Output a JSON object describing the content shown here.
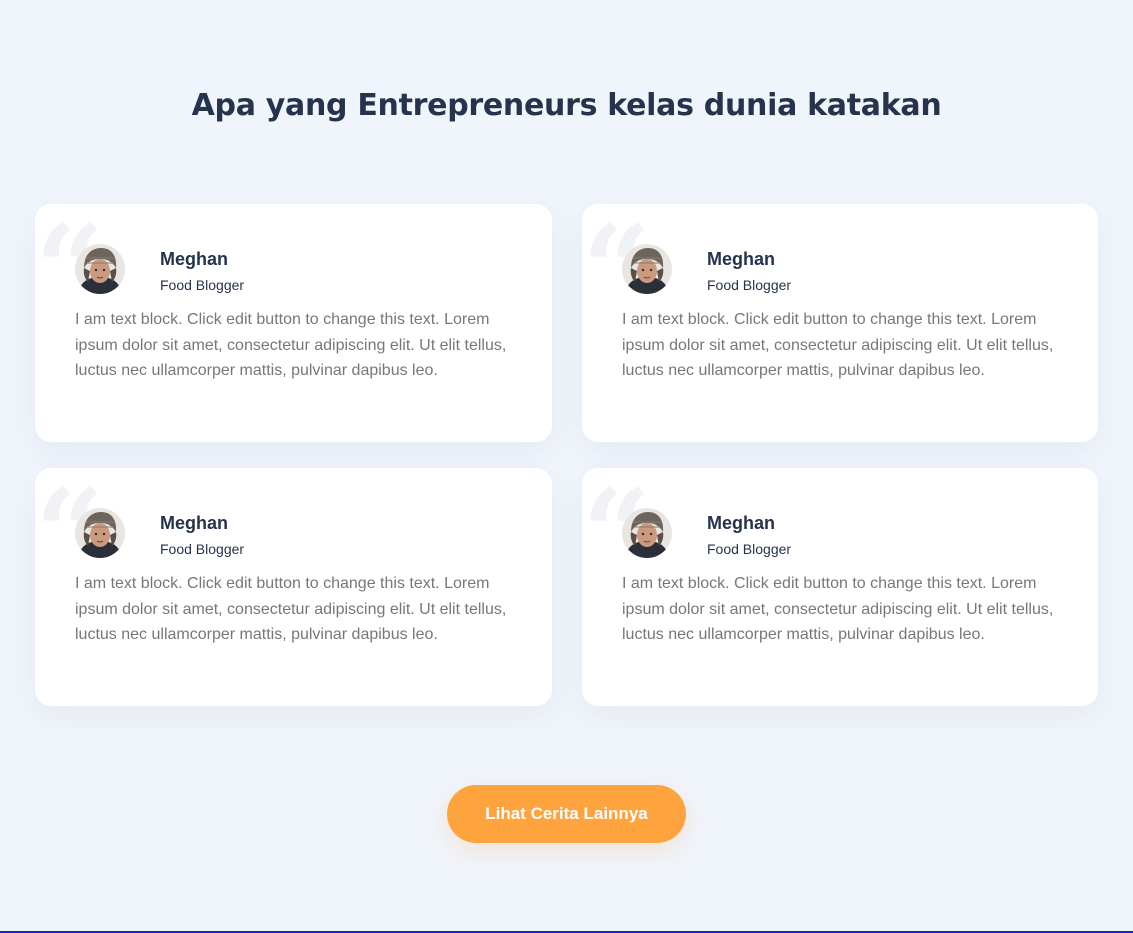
{
  "heading": "Apa yang Entrepreneurs kelas dunia katakan",
  "testimonials": [
    {
      "name": "Meghan",
      "role": "Food Blogger",
      "text": "I am text block. Click edit button to change this text. Lorem ipsum dolor sit amet, consectetur adipiscing elit. Ut elit tellus, luctus nec ullamcorper mattis, pulvinar dapibus leo."
    },
    {
      "name": "Meghan",
      "role": "Food Blogger",
      "text": "I am text block. Click edit button to change this text. Lorem ipsum dolor sit amet, consectetur adipiscing elit. Ut elit tellus, luctus nec ullamcorper mattis, pulvinar dapibus leo."
    },
    {
      "name": "Meghan",
      "role": "Food Blogger",
      "text": "I am text block. Click edit button to change this text. Lorem ipsum dolor sit amet, consectetur adipiscing elit. Ut elit tellus, luctus nec ullamcorper mattis, pulvinar dapibus leo."
    },
    {
      "name": "Meghan",
      "role": "Food Blogger",
      "text": "I am text block. Click edit button to change this text. Lorem ipsum dolor sit amet, consectetur adipiscing elit. Ut elit tellus, luctus nec ullamcorper mattis, pulvinar dapibus leo."
    }
  ],
  "cta_label": "Lihat Cerita Lainnya",
  "quote_glyph": "“",
  "icons": {
    "quote": "quote-icon",
    "avatar": "avatar"
  },
  "colors": {
    "background": "#f0f4fb",
    "heading": "#26334d",
    "body_text": "#777777",
    "cta": "#ffa33f",
    "card": "#ffffff"
  }
}
